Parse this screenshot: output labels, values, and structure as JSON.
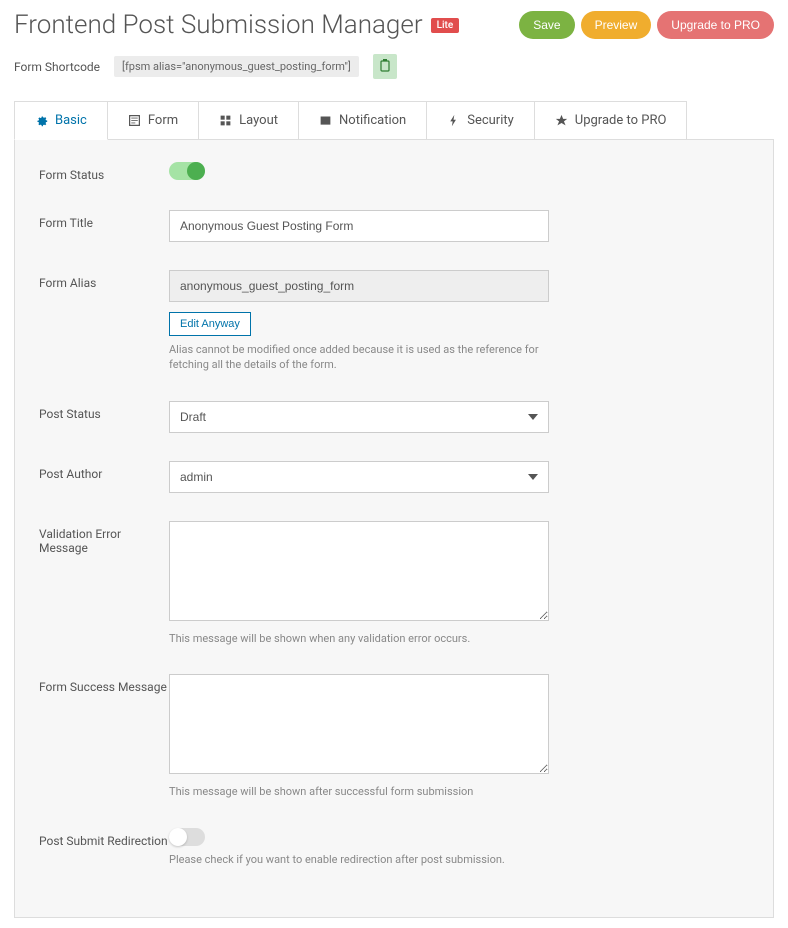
{
  "header": {
    "title": "Frontend Post Submission Manager",
    "lite_badge": "Lite",
    "save_label": "Save",
    "preview_label": "Preview",
    "upgrade_label": "Upgrade to PRO"
  },
  "shortcode": {
    "label": "Form Shortcode",
    "value": "[fpsm alias=\"anonymous_guest_posting_form\"]"
  },
  "tabs": [
    {
      "label": "Basic",
      "icon": "gear"
    },
    {
      "label": "Form",
      "icon": "form"
    },
    {
      "label": "Layout",
      "icon": "layout"
    },
    {
      "label": "Notification",
      "icon": "mail"
    },
    {
      "label": "Security",
      "icon": "bolt"
    },
    {
      "label": "Upgrade to PRO",
      "icon": "star"
    }
  ],
  "fields": {
    "form_status": {
      "label": "Form Status"
    },
    "form_title": {
      "label": "Form Title",
      "value": "Anonymous Guest Posting Form"
    },
    "form_alias": {
      "label": "Form Alias",
      "value": "anonymous_guest_posting_form",
      "edit_btn": "Edit Anyway",
      "help": "Alias cannot be modified once added because it is used as the reference for fetching all the details of the form."
    },
    "post_status": {
      "label": "Post Status",
      "value": "Draft"
    },
    "post_author": {
      "label": "Post Author",
      "value": "admin"
    },
    "validation_error": {
      "label": "Validation Error Message",
      "help": "This message will be shown when any validation error occurs."
    },
    "success_message": {
      "label": "Form Success Message",
      "help": "This message will be shown after successful form submission"
    },
    "redirection": {
      "label": "Post Submit Redirection",
      "help": "Please check if you want to enable redirection after post submission."
    }
  }
}
